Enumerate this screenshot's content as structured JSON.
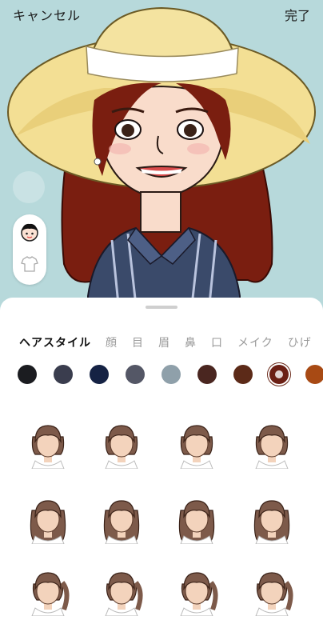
{
  "topbar": {
    "cancel_label": "キャンセル",
    "done_label": "完了"
  },
  "side_panel": {
    "items": [
      {
        "icon": "face-icon"
      },
      {
        "icon": "tshirt-icon"
      }
    ]
  },
  "editor": {
    "tabs": [
      {
        "label": "ヘアスタイル",
        "active": true
      },
      {
        "label": "顔",
        "active": false
      },
      {
        "label": "目",
        "active": false
      },
      {
        "label": "眉",
        "active": false
      },
      {
        "label": "鼻",
        "active": false
      },
      {
        "label": "口",
        "active": false
      },
      {
        "label": "メイク",
        "active": false
      },
      {
        "label": "ひげ",
        "active": false
      }
    ],
    "colors": [
      "#1b1c20",
      "#3a3d4e",
      "#152244",
      "#545766",
      "#8fa0aa",
      "#4a2620",
      "#5c2a18",
      "#6b1f14",
      "#a84a14"
    ],
    "selected_color_index": 7
  },
  "hairstyles": [
    {
      "style": "short-bob"
    },
    {
      "style": "short-wavy"
    },
    {
      "style": "side-bob"
    },
    {
      "style": "medium-bob"
    },
    {
      "style": "long-side-part"
    },
    {
      "style": "long-wavy"
    },
    {
      "style": "long-straight-bangs"
    },
    {
      "style": "long-tied-bangs"
    },
    {
      "style": "ponytail-side"
    },
    {
      "style": "ponytail-low"
    },
    {
      "style": "long-bangs"
    },
    {
      "style": "side-ponytail"
    }
  ]
}
